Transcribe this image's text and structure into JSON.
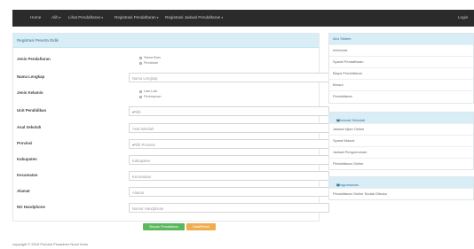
{
  "navbar": {
    "brand": "Home",
    "items": [
      {
        "label": "Alih"
      },
      {
        "label": "Lihat Pendaftaran",
        "has_caret": true
      },
      {
        "label": "Registrasi Pendaftaran",
        "has_caret": true
      },
      {
        "label": "Registrasi Jadwal Pendaftaran",
        "has_caret": true
      }
    ],
    "logout": "Login"
  },
  "form": {
    "heading": "Registrasi Peserta Didik",
    "fields": {
      "jenis_pendaftaran": {
        "label": "Jenis Pendaftaran",
        "options": [
          "Siswa Baru",
          "Pindahan"
        ]
      },
      "nama_lengkap": {
        "label": "Nama Lengkap",
        "placeholder": "Nama Lengkap"
      },
      "jenis_kelamin": {
        "label": "Jenis Kelamin",
        "options": [
          "Laki-Laki",
          "Perempuan"
        ]
      },
      "unit_pendidikan": {
        "label": "Unit Pendidikan",
        "value": "-Pilih-"
      },
      "asal_sekolah": {
        "label": "Asal Sekolah",
        "placeholder": "Asal Sekolah"
      },
      "provinsi": {
        "label": "Provinsi",
        "value": "-Pilih Provinsi-"
      },
      "kabupaten": {
        "label": "Kabupaten",
        "placeholder": "Kabupaten"
      },
      "kecamatan": {
        "label": "Kecamatan",
        "placeholder": "Kecamatan"
      },
      "alamat": {
        "label": "Alamat",
        "placeholder": "Alamat"
      },
      "no_handphone": {
        "label": "NO Handphone",
        "placeholder": "Nomor Handphone"
      }
    },
    "submit_label": "Simpan Pendaftaran",
    "reset_label": "Batal/Reset"
  },
  "sidebar_main": {
    "heading": "Alur Sistem",
    "items": [
      "Informasi",
      "Syarat Pendaftaran",
      "Biaya Pendaftaran",
      "Brosur",
      "Pendaftaran"
    ]
  },
  "sidebar_info": {
    "heading": "Informasi Sekolah",
    "items": [
      "Jadwal Ujian Online",
      "Syarat Masuk",
      "Jadwal Pengumuman",
      "Pendaftaran Online"
    ]
  },
  "sidebar_extra": {
    "heading": "Pengumuman",
    "items": [
      "Pendaftaran Online Sudah Dibuka"
    ]
  },
  "footer": {
    "text": "copyright © 2016 Pondok Pesantren Nurul Iman"
  },
  "icons": {
    "caret": "caret-down-icon",
    "radio": "radio-icon",
    "heading_badge": "info-icon"
  },
  "colors": {
    "navbar": "#2b2b2b",
    "panel_heading": "#d9edf7",
    "submit": "#5cb85c",
    "reset": "#f0ad4e"
  }
}
